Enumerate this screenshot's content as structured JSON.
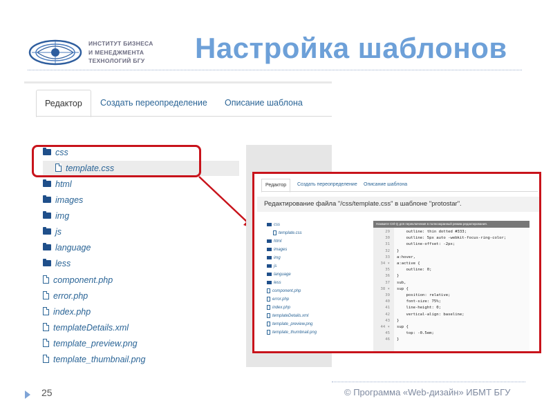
{
  "header": {
    "logo_lines": [
      "ИНСТИТУТ БИЗНЕСА",
      "И МЕНЕДЖМЕНТА",
      "ТЕХНОЛОГИЙ БГУ"
    ],
    "title": "Настройка шаблонов"
  },
  "tabs": {
    "editor": "Редактор",
    "create_override": "Создать переопределение",
    "template_description": "Описание шаблона"
  },
  "file_tree": [
    {
      "type": "folder",
      "label": "css"
    },
    {
      "type": "file",
      "label": "template.css",
      "selected": true
    },
    {
      "type": "folder",
      "label": "html"
    },
    {
      "type": "folder",
      "label": "images"
    },
    {
      "type": "folder",
      "label": "img"
    },
    {
      "type": "folder",
      "label": "js"
    },
    {
      "type": "folder",
      "label": "language"
    },
    {
      "type": "folder",
      "label": "less"
    },
    {
      "type": "file",
      "label": "component.php"
    },
    {
      "type": "file",
      "label": "error.php"
    },
    {
      "type": "file",
      "label": "index.php"
    },
    {
      "type": "file",
      "label": "templateDetails.xml"
    },
    {
      "type": "file",
      "label": "template_preview.png"
    },
    {
      "type": "file",
      "label": "template_thumbnail.png"
    }
  ],
  "inset": {
    "tabs": {
      "editor": "Редактор",
      "create_override": "Создать переопределение",
      "template_description": "Описание шаблона"
    },
    "header": "Редактирование файла \"/css/template.css\" в шаблоне \"protostar\".",
    "banner": "Нажмите Ctrl-Q для переключения в полноэкранный режим редактирования.",
    "tree": [
      "css",
      "template.css",
      "html",
      "images",
      "img",
      "js",
      "language",
      "less",
      "component.php",
      "error.php",
      "index.php",
      "templateDetails.xml",
      "template_preview.png",
      "template_thumbnail.png"
    ],
    "code_lines": [
      {
        "n": "29",
        "t": "    outline: thin dotted #333;"
      },
      {
        "n": "30",
        "t": "    outline: 5px auto -webkit-focus-ring-color;"
      },
      {
        "n": "31",
        "t": "    outline-offset: -2px;"
      },
      {
        "n": "32",
        "t": "}"
      },
      {
        "n": "33",
        "t": "a:hover,"
      },
      {
        "n": "34 ▾",
        "t": "a:active {"
      },
      {
        "n": "35",
        "t": "    outline: 0;"
      },
      {
        "n": "36",
        "t": "}"
      },
      {
        "n": "37",
        "t": "sub,"
      },
      {
        "n": "38 ▾",
        "t": "sup {"
      },
      {
        "n": "39",
        "t": "    position: relative;"
      },
      {
        "n": "40",
        "t": "    font-size: 75%;"
      },
      {
        "n": "41",
        "t": "    line-height: 0;"
      },
      {
        "n": "42",
        "t": "    vertical-align: baseline;"
      },
      {
        "n": "43",
        "t": "}"
      },
      {
        "n": "44 ▾",
        "t": "sup {"
      },
      {
        "n": "45",
        "t": "    top: -0.5em;"
      },
      {
        "n": "46",
        "t": "}"
      }
    ]
  },
  "footer": {
    "page_number": "25",
    "text": "© Программа «Web-дизайн» ИБМТ БГУ"
  },
  "colors": {
    "title": "#6da0d8",
    "link": "#2a6496",
    "highlight_red": "#c8131b"
  }
}
